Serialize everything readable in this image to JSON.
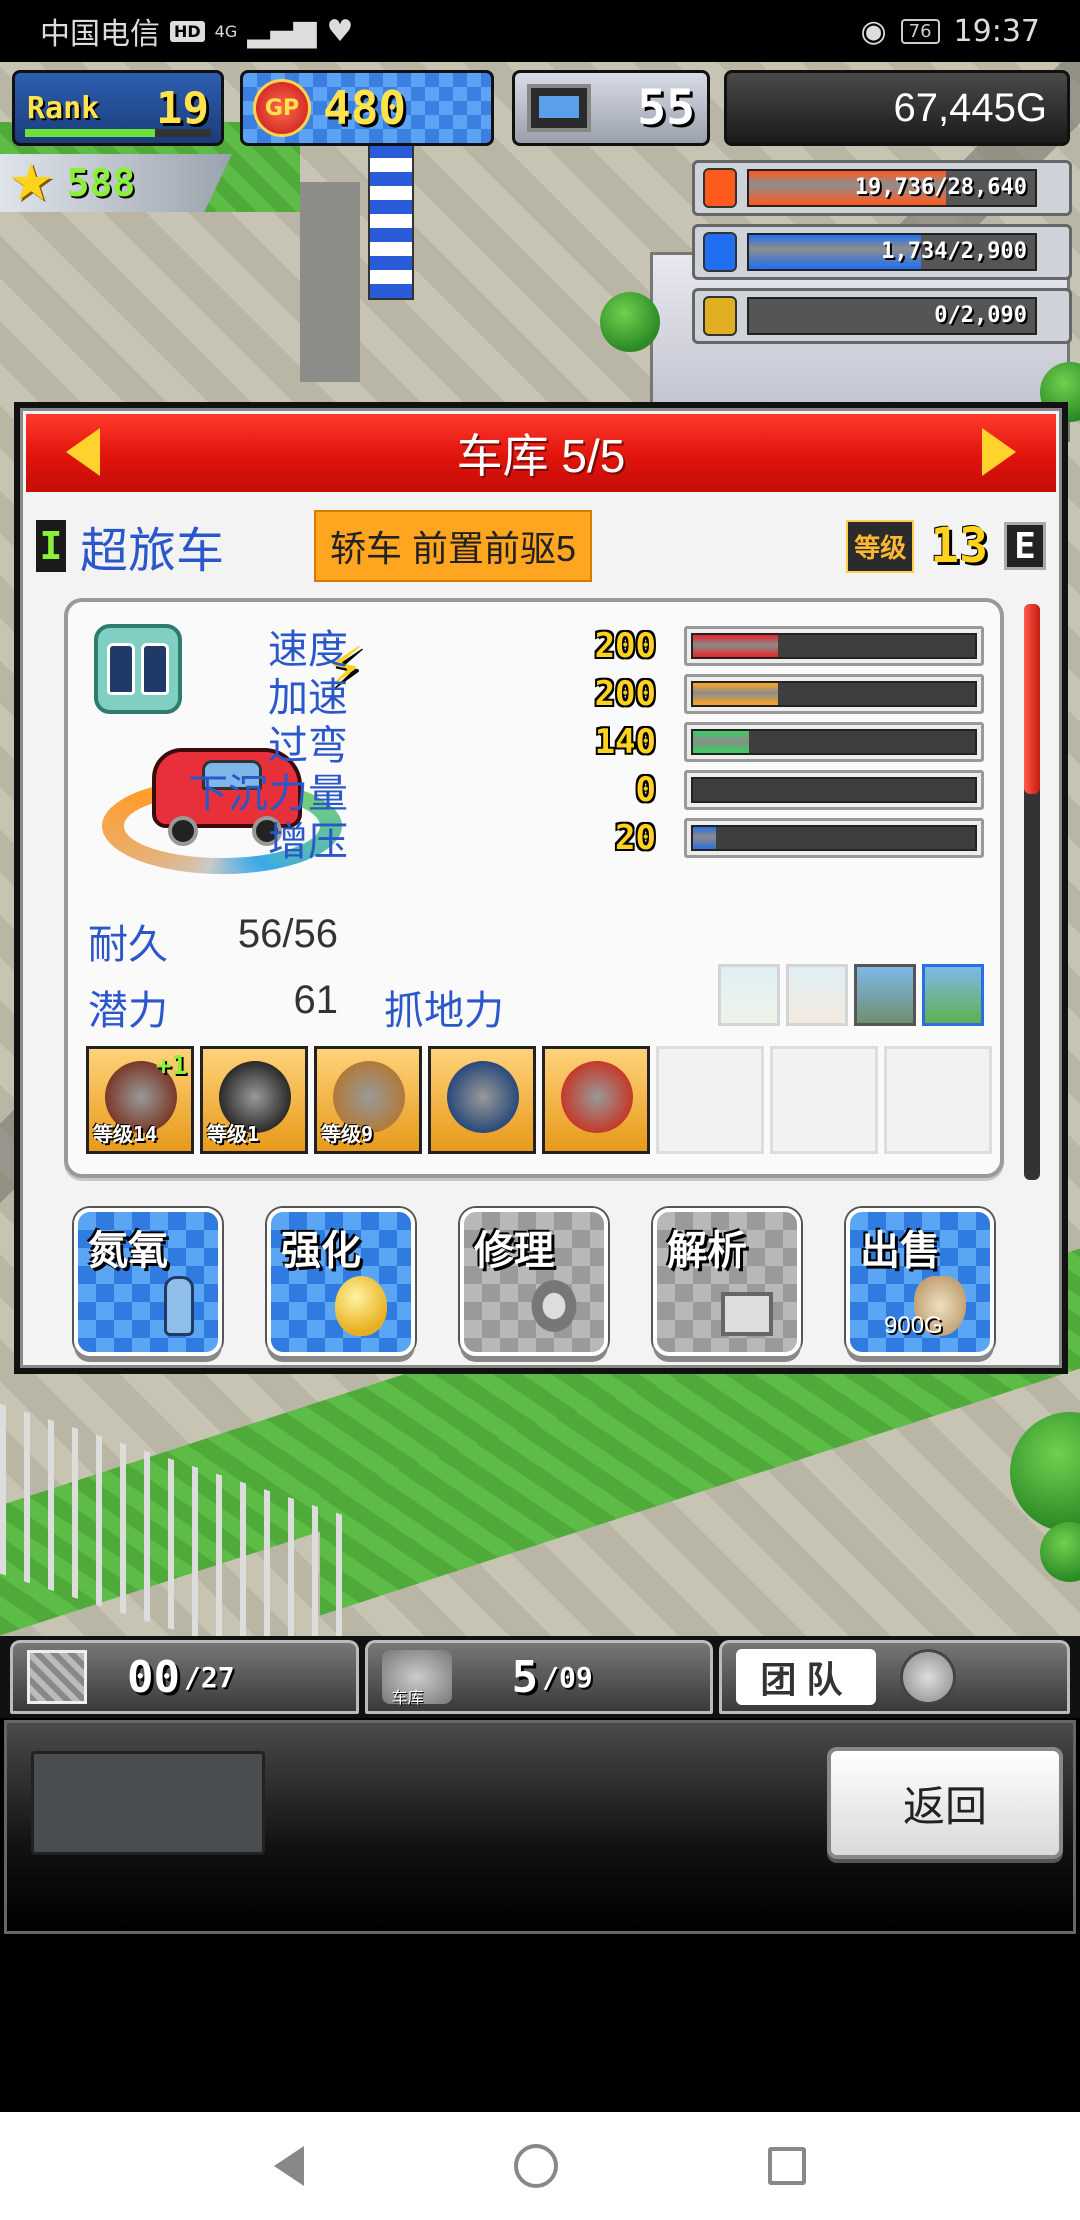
{
  "status_bar": {
    "carrier": "中国电信",
    "hd": "HD",
    "net": "4G",
    "battery": "76",
    "time": "19:37"
  },
  "hud": {
    "rank_label": "Rank",
    "rank_value": "19",
    "rank_progress": 0.7,
    "gp_icon": "GP",
    "gp_value": "480",
    "pc_value": "55",
    "money": "67,445G",
    "stars": "588",
    "resources": [
      {
        "icon": "coin-icon",
        "text": "19,736/28,640",
        "fill": 0.69,
        "color": "#ff5a1e"
      },
      {
        "icon": "fuel-bottle-icon",
        "text": "1,734/2,900",
        "fill": 0.6,
        "color": "#1f6ff0"
      },
      {
        "icon": "wheat-icon",
        "text": "0/2,090",
        "fill": 0,
        "color": "#e0b020"
      }
    ]
  },
  "dialog": {
    "title": "车库 5/5",
    "class_badge": "I",
    "car_name": "超旅车",
    "car_type": "轿车 前置前驱5",
    "level_label": "等级",
    "level_value": "13",
    "grade": "E",
    "stats": [
      {
        "label": "速度",
        "value": "200",
        "fill": 0.3,
        "color": "#e8242a"
      },
      {
        "label": "加速",
        "value": "200",
        "fill": 0.3,
        "color": "#ffa520"
      },
      {
        "label": "过弯",
        "value": "140",
        "fill": 0.2,
        "color": "#38d060"
      },
      {
        "label": "下沉力量",
        "value": "0",
        "fill": 0,
        "color": "#38d060"
      },
      {
        "label": "增压",
        "value": "20",
        "fill": 0.08,
        "color": "#2a6fe0"
      }
    ],
    "durability_label": "耐久",
    "durability_value": "56/56",
    "potential_label": "潜力",
    "potential_value": "61",
    "grip_label": "抓地力",
    "parts": [
      {
        "name": "engine-part",
        "level": "等级14",
        "plus": "+1"
      },
      {
        "name": "tire-part",
        "level": "等级1",
        "plus": ""
      },
      {
        "name": "brake-part",
        "level": "等级9",
        "plus": ""
      },
      {
        "name": "chain-tire-part",
        "level": "",
        "plus": ""
      },
      {
        "name": "oil-can-part",
        "level": "",
        "plus": ""
      }
    ],
    "actions": [
      {
        "label": "氮氧",
        "price": "",
        "enabled": true
      },
      {
        "label": "强化",
        "price": "",
        "enabled": true
      },
      {
        "label": "修理",
        "price": "",
        "enabled": false
      },
      {
        "label": "解析",
        "price": "",
        "enabled": false
      },
      {
        "label": "出售",
        "price": "900G",
        "enabled": true
      }
    ]
  },
  "bottom_tabs": {
    "items_value": "00",
    "items_max": "/27",
    "garage_label": "车库",
    "garage_value": "5",
    "garage_max": "/09",
    "team_label": "团队"
  },
  "bottom_panel": {
    "back_label": "返回"
  }
}
